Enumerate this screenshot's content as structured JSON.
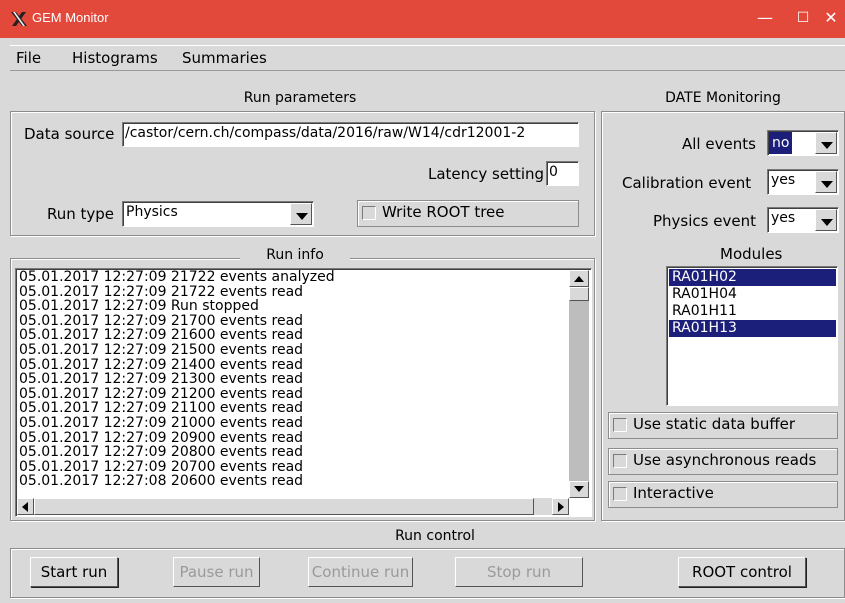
{
  "window": {
    "title": "GEM Monitor",
    "minimize": "—",
    "maximize": "☐",
    "close": "✕"
  },
  "menu": {
    "file": "File",
    "histograms": "Histograms",
    "summaries": "Summaries"
  },
  "run_parameters": {
    "legend": "Run parameters",
    "data_source_label": "Data source",
    "data_source_value": "/castor/cern.ch/compass/data/2016/raw/W14/cdr12001-2",
    "latency_label": "Latency setting",
    "latency_value": "0",
    "run_type_label": "Run type",
    "run_type_value": "Physics",
    "write_root_tree": "Write ROOT tree"
  },
  "run_info": {
    "legend": "Run info",
    "lines": [
      "05.01.2017 12:27:09 21722 events analyzed",
      "05.01.2017 12:27:09 21722 events read",
      "05.01.2017 12:27:09 Run stopped",
      "05.01.2017 12:27:09 21700 events read",
      "05.01.2017 12:27:09 21600 events read",
      "05.01.2017 12:27:09 21500 events read",
      "05.01.2017 12:27:09 21400 events read",
      "05.01.2017 12:27:09 21300 events read",
      "05.01.2017 12:27:09 21200 events read",
      "05.01.2017 12:27:09 21100 events read",
      "05.01.2017 12:27:09 21000 events read",
      "05.01.2017 12:27:09 20900 events read",
      "05.01.2017 12:27:09 20800 events read",
      "05.01.2017 12:27:09 20700 events read",
      "05.01.2017 12:27:08 20600 events read"
    ]
  },
  "date_monitoring": {
    "legend": "DATE Monitoring",
    "all_events_label": "All events",
    "all_events_value": "no",
    "calibration_label": "Calibration event",
    "calibration_value": "yes",
    "physics_label": "Physics event",
    "physics_value": "yes",
    "modules_label": "Modules",
    "modules": [
      {
        "name": "RA01H02",
        "selected": true
      },
      {
        "name": "RA01H04",
        "selected": false
      },
      {
        "name": "RA01H11",
        "selected": false
      },
      {
        "name": "RA01H13",
        "selected": true
      }
    ],
    "static_buffer": "Use static data buffer",
    "async_reads": "Use asynchronous reads",
    "interactive": "Interactive"
  },
  "run_control": {
    "legend": "Run control",
    "start": "Start run",
    "pause": "Pause run",
    "continue": "Continue run",
    "stop": "Stop run",
    "root_control": "ROOT control"
  },
  "colors": {
    "titlebar": "#e3493a",
    "selection": "#1b1f7a",
    "background": "#d9d9d9"
  }
}
